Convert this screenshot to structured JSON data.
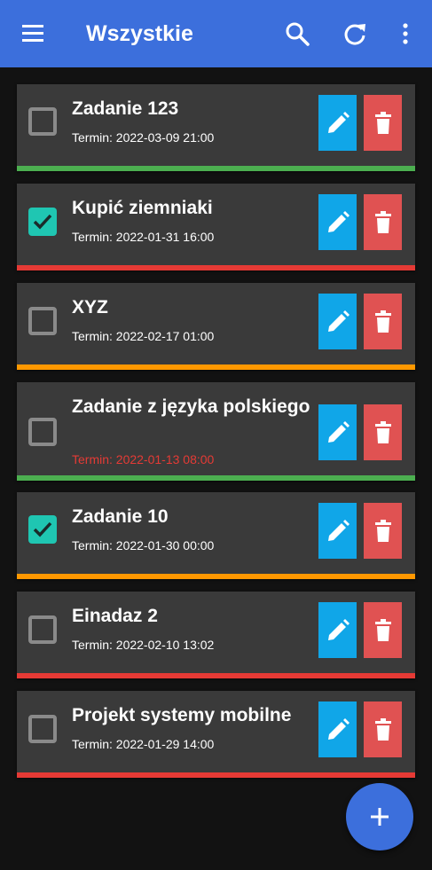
{
  "app_bar": {
    "title": "Wszystkie",
    "background": "#3c6fdc",
    "icons": [
      "menu-icon",
      "search-icon",
      "refresh-icon",
      "more-vert-icon"
    ]
  },
  "colors": {
    "card": "#3a3a3a",
    "checked": "#1fc6b2",
    "edit": "#10a6e8",
    "delete": "#e05252",
    "overdue": "#e53a35",
    "priority_green": "#4caf50",
    "priority_red": "#e53a35",
    "priority_orange": "#ff9800"
  },
  "tasks": [
    {
      "title": "Zadanie 123",
      "due": "Termin: 2022-03-09 21:00",
      "checked": false,
      "overdue": false,
      "priority": "green"
    },
    {
      "title": "Kupić ziemniaki",
      "due": "Termin: 2022-01-31 16:00",
      "checked": true,
      "overdue": false,
      "priority": "red"
    },
    {
      "title": "XYZ",
      "due": "Termin: 2022-02-17 01:00",
      "checked": false,
      "overdue": false,
      "priority": "orange"
    },
    {
      "title": "Zadanie z języka polskiego",
      "due": "Termin: 2022-01-13 08:00",
      "checked": false,
      "overdue": true,
      "priority": "green"
    },
    {
      "title": "Zadanie 10",
      "due": "Termin: 2022-01-30 00:00",
      "checked": true,
      "overdue": false,
      "priority": "orange"
    },
    {
      "title": "Einadaz 2",
      "due": "Termin: 2022-02-10 13:02",
      "checked": false,
      "overdue": false,
      "priority": "red"
    },
    {
      "title": "Projekt systemy mobilne",
      "due": "Termin: 2022-01-29 14:00",
      "checked": false,
      "overdue": false,
      "priority": "red"
    }
  ],
  "fab_icon": "add-icon"
}
